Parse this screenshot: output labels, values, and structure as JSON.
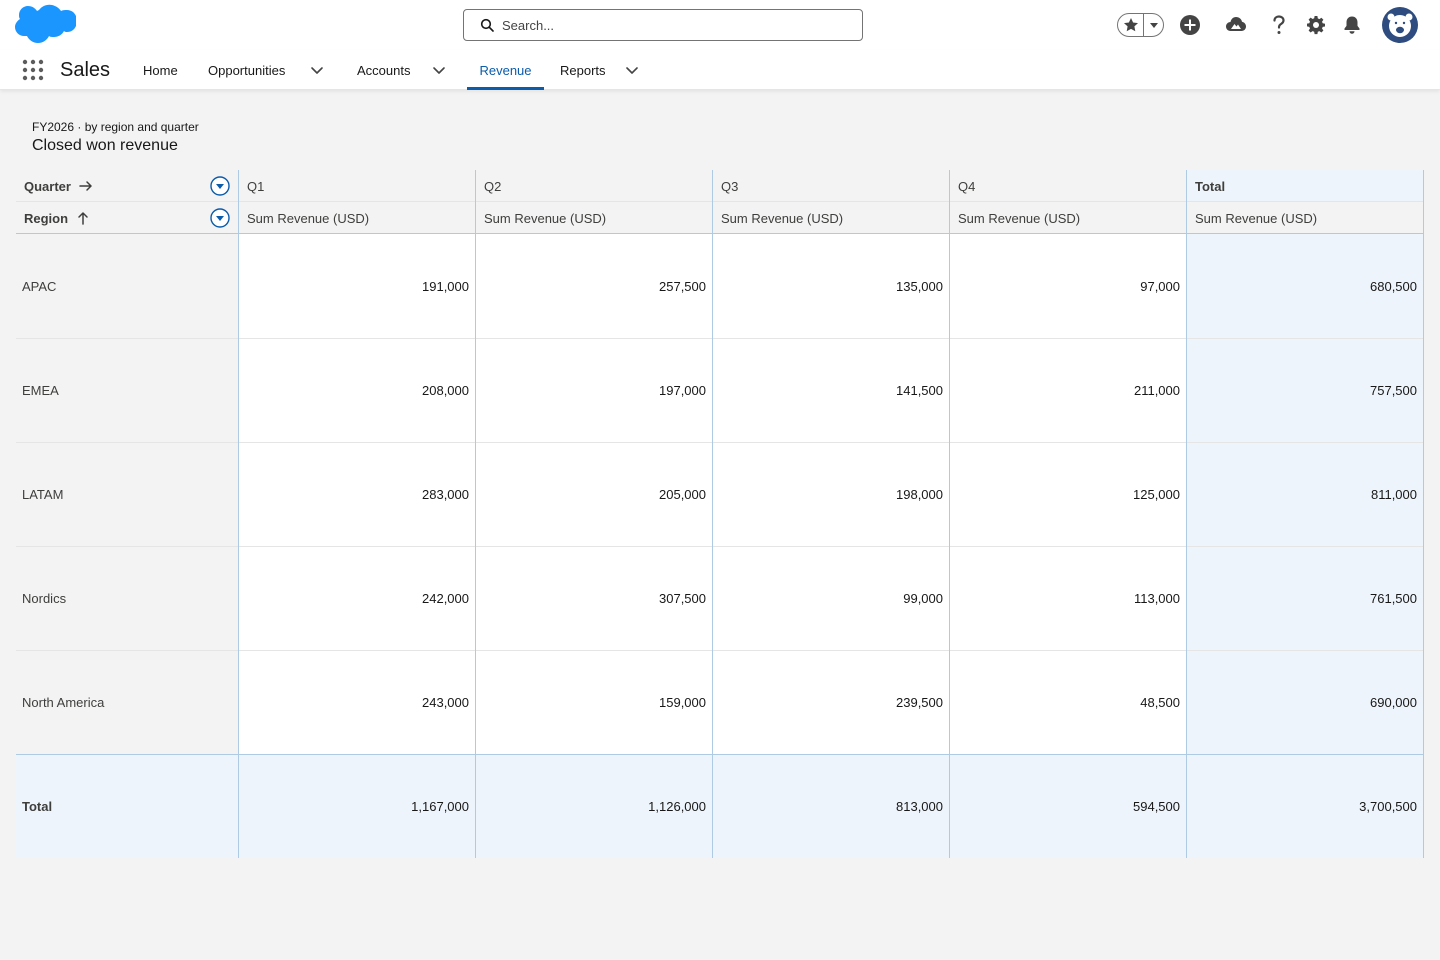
{
  "header": {
    "search_placeholder": "Search...",
    "brand_color": "#1b96ff"
  },
  "nav": {
    "app_name": "Sales",
    "items": [
      {
        "label": "Home"
      },
      {
        "label": "Opportunities"
      },
      {
        "label": "Accounts"
      },
      {
        "label": "Revenue"
      },
      {
        "label": "Reports"
      }
    ],
    "active_item": "Revenue"
  },
  "report": {
    "subtitle": "FY2026 · by region and quarter",
    "title": "Closed won revenue",
    "column_grouping_label": "Quarter",
    "row_grouping_label": "Region",
    "columns": [
      "Q1",
      "Q2",
      "Q3",
      "Q4",
      "Total"
    ],
    "measure_label": "Sum Revenue (USD)",
    "rows": [
      {
        "region": "APAC",
        "values": [
          "191,000",
          "257,500",
          "135,000",
          "97,000",
          "680,500"
        ]
      },
      {
        "region": "EMEA",
        "values": [
          "208,000",
          "197,000",
          "141,500",
          "211,000",
          "757,500"
        ]
      },
      {
        "region": "LATAM",
        "values": [
          "283,000",
          "205,000",
          "198,000",
          "125,000",
          "811,000"
        ]
      },
      {
        "region": "Nordics",
        "values": [
          "242,000",
          "307,500",
          "99,000",
          "113,000",
          "761,500"
        ]
      },
      {
        "region": "North America",
        "values": [
          "243,000",
          "159,000",
          "239,500",
          "48,500",
          "690,000"
        ]
      }
    ],
    "total_row": {
      "label": "Total",
      "values": [
        "1,167,000",
        "1,126,000",
        "813,000",
        "594,500",
        "3,700,500"
      ]
    }
  }
}
